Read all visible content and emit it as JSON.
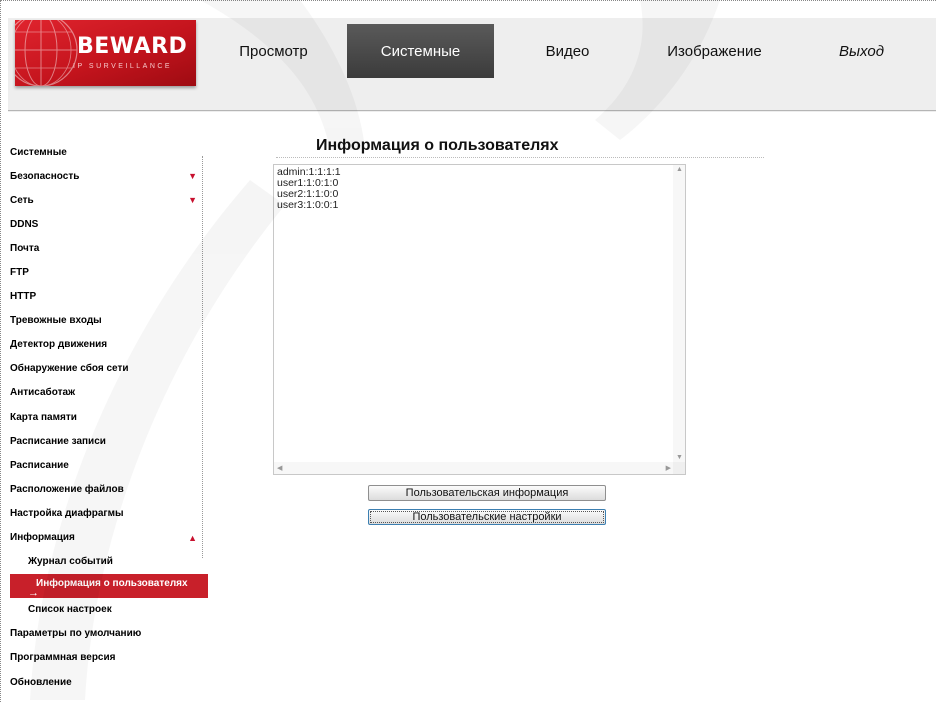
{
  "logo": {
    "brand": "BEWARD",
    "tagline": "IP SURVEILLANCE"
  },
  "nav": {
    "tabs": [
      {
        "label": "Просмотр"
      },
      {
        "label": "Системные",
        "active": true
      },
      {
        "label": "Видео"
      },
      {
        "label": "Изображение"
      },
      {
        "label": "Выход"
      }
    ]
  },
  "sidebar": {
    "items": [
      {
        "label": "Системные"
      },
      {
        "label": "Безопасность",
        "arrow": "▼"
      },
      {
        "label": "Сеть",
        "arrow": "▼"
      },
      {
        "label": "DDNS"
      },
      {
        "label": "Почта"
      },
      {
        "label": "FTP"
      },
      {
        "label": "HTTP"
      },
      {
        "label": "Тревожные входы"
      },
      {
        "label": "Детектор движения"
      },
      {
        "label": "Обнаружение сбоя сети"
      },
      {
        "label": "Антисаботаж"
      },
      {
        "label": "Карта памяти"
      },
      {
        "label": "Расписание записи"
      },
      {
        "label": "Расписание"
      },
      {
        "label": "Расположение файлов"
      },
      {
        "label": "Настройка диафрагмы"
      },
      {
        "label": "Информация",
        "arrow": "▲"
      },
      {
        "label": "Журнал событий"
      },
      {
        "label": "Информация о пользователях",
        "current_marker": "→"
      },
      {
        "label": "Список настроек"
      },
      {
        "label": "Параметры по умолчанию"
      },
      {
        "label": "Программная версия"
      },
      {
        "label": "Обновление"
      }
    ]
  },
  "main": {
    "title": "Информация о пользователях",
    "user_info_text": "admin:1:1:1:1\nuser1:1:0:1:0\nuser2:1:1:0:0\nuser3:1:0:0:1",
    "buttons": {
      "user_info": "Пользовательская информация",
      "user_settings": "Пользовательские настройки"
    }
  },
  "colors": {
    "accent_red": "#c8202a",
    "active_tab": "#444444",
    "header_bg": "#eeeeee"
  }
}
